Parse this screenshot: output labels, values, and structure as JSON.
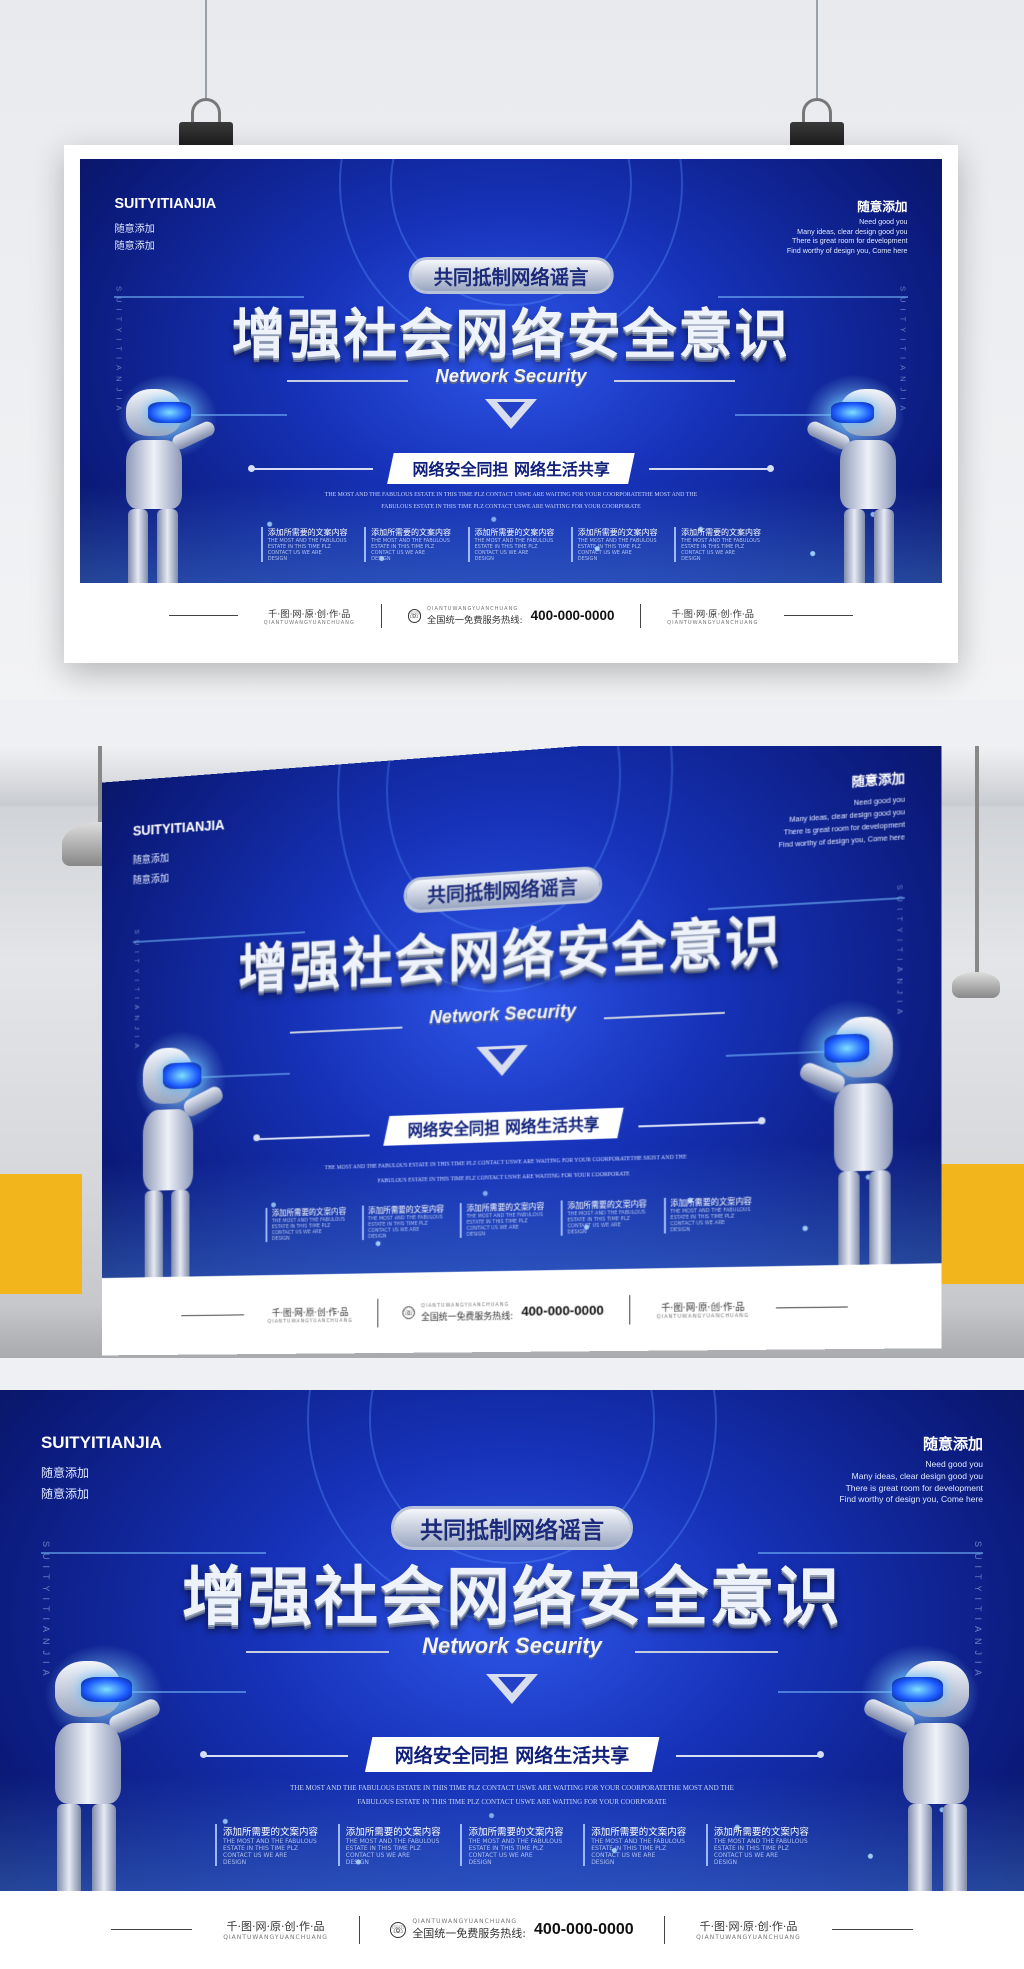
{
  "poster": {
    "brand": "SUITYITIANJIA",
    "sub_lines": [
      "随意添加",
      "随意添加"
    ],
    "right_title": "随意添加",
    "right_lines": [
      "Need good you",
      "Many ideas, clear design good you",
      "There is great room for development",
      "Find worthy of design you, Come here"
    ],
    "vertical_text": "SUITYITIANJIA",
    "pill": "共同抵制网络谣言",
    "title": "增强社会网络安全意识",
    "title_en": "Network Security",
    "slogan": "网络安全同担  网络生活共享",
    "fine_lines": [
      "THE MOST AND THE FABULOUS ESTATE IN THIS TIME PLZ CONTACT USWE ARE WAITING FOR YOUR COORPORATETHE MOST AND THE",
      "FABULOUS ESTATE IN THIS TIME PLZ CONTACT USWE ARE WAITING FOR YOUR COORPORATE"
    ],
    "items": [
      {
        "head": "添加所需要的文案内容",
        "lines": [
          "THE MOST AND THE FABULOUS",
          "ESTATE IN THIS TIME PLZ",
          "CONTACT US WE ARE",
          "DESIGN"
        ]
      },
      {
        "head": "添加所需要的文案内容",
        "lines": [
          "THE MOST AND THE FABULOUS",
          "ESTATE IN THIS TIME PLZ",
          "CONTACT US WE ARE",
          "DESIGN"
        ]
      },
      {
        "head": "添加所需要的文案内容",
        "lines": [
          "THE MOST AND THE FABULOUS",
          "ESTATE IN THIS TIME PLZ",
          "CONTACT US WE ARE",
          "DESIGN"
        ]
      },
      {
        "head": "添加所需要的文案内容",
        "lines": [
          "THE MOST AND THE FABULOUS",
          "ESTATE IN THIS TIME PLZ",
          "CONTACT US WE ARE",
          "DESIGN"
        ]
      },
      {
        "head": "添加所需要的文案内容",
        "lines": [
          "THE MOST AND THE FABULOUS",
          "ESTATE IN THIS TIME PLZ",
          "CONTACT US WE ARE",
          "DESIGN"
        ]
      }
    ],
    "footer": {
      "left": "千·图·网·原·创·作·品",
      "left_small": "QIANTUWANGYUANCHUANG",
      "hotline_label": "全国统一免费服务热线:",
      "hotline_small": "QIANTUWANGYUANCHUANG",
      "phone": "400-000-0000",
      "right": "千·图·网·原·创·作·品",
      "right_small": "QIANTUWANGYUANCHUANG"
    }
  },
  "colors": {
    "bg_blue": "#1632b8",
    "deep_blue": "#0b1a7a",
    "accent": "#4fb6ff"
  },
  "icons": [
    "phone-icon",
    "robot-figure",
    "v-mark-icon"
  ]
}
